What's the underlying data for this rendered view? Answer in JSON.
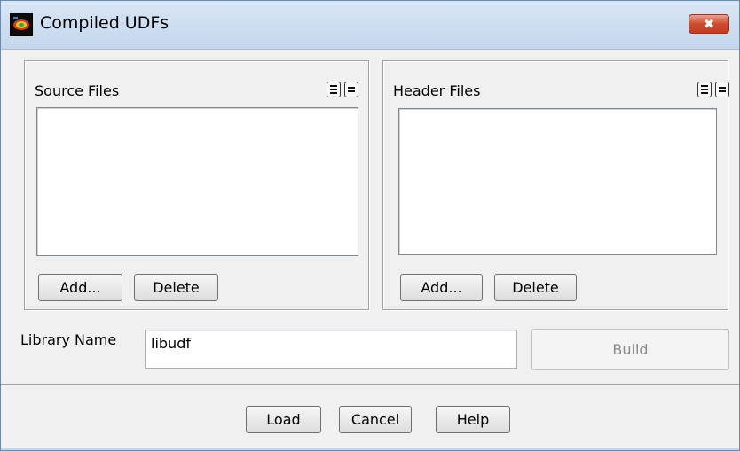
{
  "window": {
    "title": "Compiled UDFs",
    "close_label": "✖"
  },
  "source_files": {
    "label": "Source Files",
    "add_label": "Add...",
    "delete_label": "Delete",
    "items": []
  },
  "header_files": {
    "label": "Header Files",
    "add_label": "Add...",
    "delete_label": "Delete",
    "items": []
  },
  "library": {
    "label": "Library Name",
    "value": "libudf",
    "build_label": "Build"
  },
  "footer": {
    "load_label": "Load",
    "cancel_label": "Cancel",
    "help_label": "Help"
  }
}
